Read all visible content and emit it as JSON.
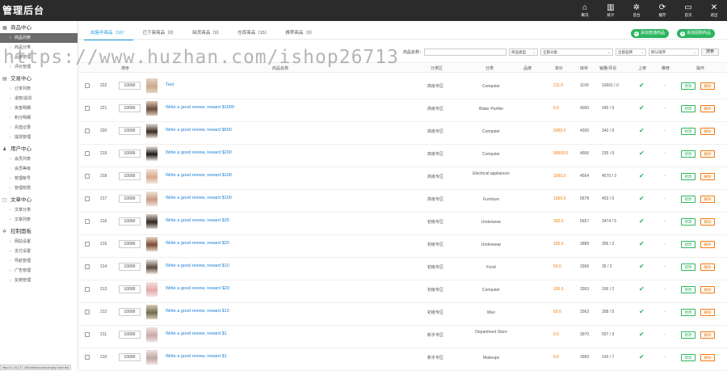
{
  "brand": "管理后台",
  "top_nav": [
    {
      "label": "概况",
      "icon": "home-icon",
      "glyph": "⌂"
    },
    {
      "label": "统计",
      "icon": "bar-chart-icon",
      "glyph": "▥"
    },
    {
      "label": "首台",
      "icon": "gear-icon",
      "glyph": "✲"
    },
    {
      "label": "缓存",
      "icon": "refresh-icon",
      "glyph": "⟳"
    },
    {
      "label": "首页",
      "icon": "monitor-icon",
      "glyph": "▭"
    },
    {
      "label": "退出",
      "icon": "close-icon",
      "glyph": "✕"
    }
  ],
  "sidebar": [
    {
      "title": "商品中心",
      "icon": "grid-icon",
      "items": [
        "商品列表",
        "商品分类",
        "品牌管理",
        "评价管理"
      ],
      "active": 0
    },
    {
      "title": "交易中心",
      "icon": "list-icon",
      "items": [
        "订单列表",
        "退款/退货",
        "资金明细",
        "积分明细",
        "充值记录",
        "提现管理"
      ],
      "active": -1
    },
    {
      "title": "用户中心",
      "icon": "user-icon",
      "items": [
        "会员列表",
        "会员等级",
        "管理帐号",
        "管理权限"
      ],
      "active": -1
    },
    {
      "title": "文章中心",
      "icon": "document-icon",
      "items": [
        "文章分类",
        "文章列表"
      ],
      "active": -1
    },
    {
      "title": "控制面板",
      "icon": "settings-icon",
      "items": [
        "网站设置",
        "支付设置",
        "导航管理",
        "广告管理",
        "友链管理"
      ],
      "active": -1
    }
  ],
  "tabs": [
    "出售中商品（16）",
    "已下架商品（0）",
    "缺货商品（0）",
    "仓库商品（15）",
    "推荐商品（0）"
  ],
  "actions": {
    "add_normal": "添加普通商品",
    "add_group": "添加团购商品"
  },
  "filters": {
    "name_label": "商品名称：",
    "name_value": "",
    "type_select": "商品类型",
    "category_select": "全部分类",
    "all_select": "全部品牌",
    "sort_select": "默认排序",
    "search_btn": "搜索"
  },
  "columns": {
    "sort": "排序",
    "name": "商品名称",
    "zone": "分类区",
    "category": "分类",
    "brand": "品牌",
    "price": "单价",
    "stock": "库存",
    "sales": "销量/评论",
    "onsale": "上架",
    "recommend": "推荐",
    "ops": "操作"
  },
  "row_buttons": {
    "edit": "修改",
    "delete": "删除"
  },
  "rows": [
    {
      "id": "222",
      "sort": "10000",
      "name": "Test",
      "zone": "高级专区",
      "category": "Computer",
      "price": "211.0",
      "stock": "1109",
      "sales": "10001 / 0",
      "recommend": "-",
      "thumb": [
        "#caa88d",
        "#e6d4c4"
      ]
    },
    {
      "id": "221",
      "sort": "10000",
      "name": "Write a good review, reward $1000",
      "zone": "高级专区",
      "category": "Water Purifier",
      "price": "0.0",
      "stock": "4000",
      "sales": "345 / 0",
      "recommend": "-",
      "thumb": [
        "#6b4b3a",
        "#d8c7b8"
      ]
    },
    {
      "id": "220",
      "sort": "10000",
      "name": "Write a good review, reward $500",
      "zone": "高级专区",
      "category": "Computer",
      "price": "5000.0",
      "stock": "4200",
      "sales": "343 / 0",
      "recommend": "-",
      "thumb": [
        "#3a2a22",
        "#e8e1da"
      ]
    },
    {
      "id": "219",
      "sort": "10000",
      "name": "Write a good review, reward $200",
      "zone": "高级专区",
      "category": "Computer",
      "price": "50000.0",
      "stock": "4566",
      "sales": "235 / 0",
      "recommend": "-",
      "thumb": [
        "#1f1a18",
        "#efe9e4"
      ]
    },
    {
      "id": "218",
      "sort": "10000",
      "name": "Write a good review, reward $100",
      "zone": "高级专区",
      "category": "Electrical appliances",
      "price": "1000.0",
      "stock": "4564",
      "sales": "4570 / 3",
      "recommend": "-",
      "thumb": [
        "#d9a98d",
        "#f2e6dd"
      ]
    },
    {
      "id": "217",
      "sort": "10000",
      "name": "Write a good review, reward $100",
      "zone": "高级专区",
      "category": "Furniture",
      "price": "1000.0",
      "stock": "5678",
      "sales": "453 / 0",
      "recommend": "-",
      "thumb": [
        "#c79b83",
        "#efe2d8"
      ]
    },
    {
      "id": "216",
      "sort": "10000",
      "name": "Write a good review, reward $35",
      "zone": "初级专区",
      "category": "Underwear",
      "price": "300.0",
      "stock": "5657",
      "sales": "3474 / 5",
      "recommend": "-",
      "thumb": [
        "#2d2723",
        "#d9cfc6"
      ]
    },
    {
      "id": "215",
      "sort": "10000",
      "name": "Write a good review, reward $20",
      "zone": "初级专区",
      "category": "Underwear",
      "price": "100.0",
      "stock": "3989",
      "sales": "356 / 2",
      "recommend": "-",
      "thumb": [
        "#7a4a33",
        "#e7d9ce"
      ]
    },
    {
      "id": "214",
      "sort": "10000",
      "name": "Write a good review, reward $10",
      "zone": "初级专区",
      "category": "Food",
      "price": "50.0",
      "stock": "3366",
      "sales": "35 / 2",
      "recommend": "-",
      "thumb": [
        "#5b4a40",
        "#eae3dc"
      ]
    },
    {
      "id": "213",
      "sort": "10000",
      "name": "Write a good review, reward $20",
      "zone": "初级专区",
      "category": "Computer",
      "price": "100.0",
      "stock": "3363",
      "sales": "156 / 2",
      "recommend": "-",
      "thumb": [
        "#e3a9a8",
        "#f6e3e2"
      ]
    },
    {
      "id": "212",
      "sort": "10000",
      "name": "Write a good review, reward $10",
      "zone": "初级专区",
      "category": "Man",
      "price": "50.0",
      "stock": "3363",
      "sales": "358 / 5",
      "recommend": "-",
      "thumb": [
        "#6f6a4a",
        "#d6d1bb"
      ]
    },
    {
      "id": "211",
      "sort": "10000",
      "name": "Write a good review, reward $1",
      "zone": "新手专区",
      "category": "Department Store",
      "price": "0.0",
      "stock": "3970",
      "sales": "597 / 3",
      "recommend": "-",
      "thumb": [
        "#c9a9a6",
        "#efe3e2"
      ]
    },
    {
      "id": "210",
      "sort": "10000",
      "name": "Write a good review, reward $1",
      "zone": "新手专区",
      "category": "Makeups",
      "price": "0.0",
      "stock": "3960",
      "sales": "143 / 7",
      "recommend": "-",
      "thumb": [
        "#bfa7a4",
        "#eee3e1"
      ]
    }
  ],
  "watermark": "https://www.huzhan.com/ishop26713",
  "status_url": "http://1.16.177.150/admin/product.php?act=list",
  "colors": {
    "accent": "#1a9cdd",
    "green": "#2db560",
    "orange": "#f07a0e",
    "topbar": "#2b2b2b"
  }
}
